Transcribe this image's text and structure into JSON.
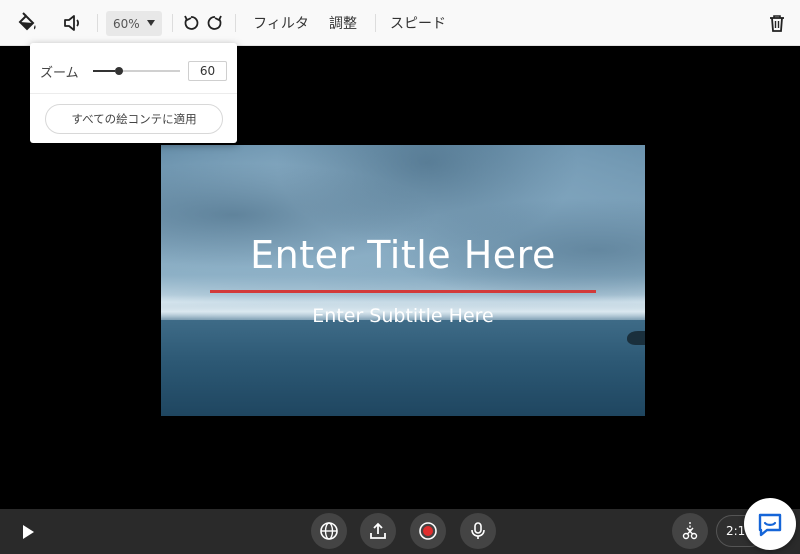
{
  "toolbar": {
    "icons": {
      "fill": "paint-bucket-icon",
      "volume": "volume-icon",
      "undo": "undo-icon",
      "redo": "redo-icon",
      "delete": "trash-icon"
    },
    "zoom_value": "60%",
    "filter_label": "フィルタ",
    "adjust_label": "調整",
    "speed_label": "スピード"
  },
  "zoom_popover": {
    "label": "ズーム",
    "slider_value": 60,
    "slider_min": 0,
    "slider_max": 100,
    "input_value": "60",
    "apply_button": "すべての絵コンテに適用"
  },
  "preview": {
    "title": "Enter Title Here",
    "subtitle": "Enter Subtitle Here",
    "accent_line_color": "#d23a3a"
  },
  "bottombar": {
    "icons": {
      "play": "play-icon",
      "globe": "globe-icon",
      "upload": "upload-icon",
      "record": "record-icon",
      "mic": "microphone-icon",
      "split": "split-scissors-icon",
      "chat": "chat-icon"
    },
    "record_color": "#e02d2d",
    "aspect_ratio": "2:1"
  },
  "colors": {
    "toolbar_bg": "#f9f9f9",
    "canvas_bg": "#000000",
    "bottombar_bg": "#2a2a2a"
  }
}
